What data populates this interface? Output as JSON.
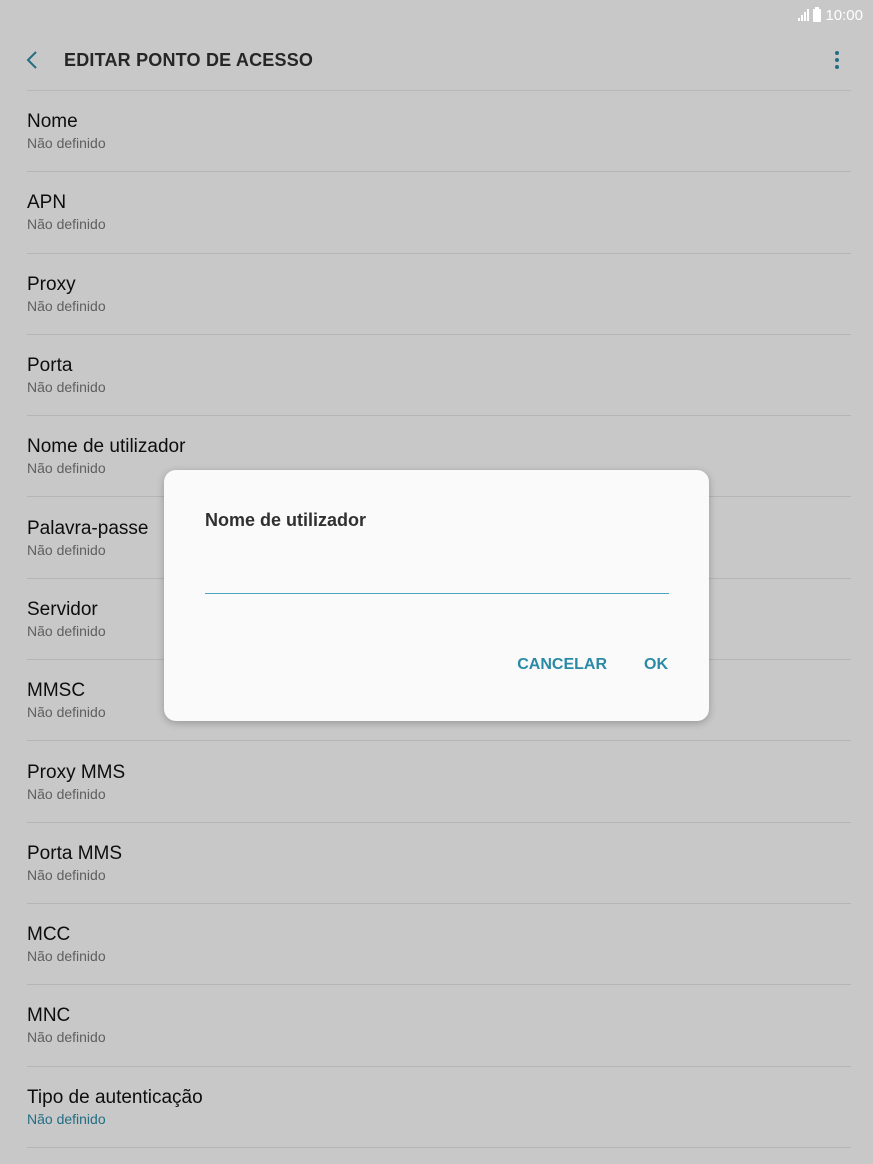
{
  "status_bar": {
    "time": "10:00"
  },
  "app_bar": {
    "title": "EDITAR PONTO DE ACESSO"
  },
  "settings": {
    "items": [
      {
        "title": "Nome",
        "value": "Não definido"
      },
      {
        "title": "APN",
        "value": "Não definido"
      },
      {
        "title": "Proxy",
        "value": "Não definido"
      },
      {
        "title": "Porta",
        "value": "Não definido"
      },
      {
        "title": "Nome de utilizador",
        "value": "Não definido"
      },
      {
        "title": "Palavra-passe",
        "value": "Não definido"
      },
      {
        "title": "Servidor",
        "value": "Não definido"
      },
      {
        "title": "MMSC",
        "value": "Não definido"
      },
      {
        "title": "Proxy MMS",
        "value": "Não definido"
      },
      {
        "title": "Porta MMS",
        "value": "Não definido"
      },
      {
        "title": "MCC",
        "value": "Não definido"
      },
      {
        "title": "MNC",
        "value": "Não definido"
      },
      {
        "title": "Tipo de autenticação",
        "value": "Não definido"
      }
    ]
  },
  "dialog": {
    "title": "Nome de utilizador",
    "input_value": "",
    "cancel_label": "CANCELAR",
    "ok_label": "OK"
  },
  "colors": {
    "accent": "#2a8aa6",
    "input_underline": "#4aa6bd"
  },
  "icons": {
    "back": "chevron-left-icon",
    "more": "more-vertical-icon",
    "signal": "signal-icon",
    "battery": "battery-icon"
  }
}
